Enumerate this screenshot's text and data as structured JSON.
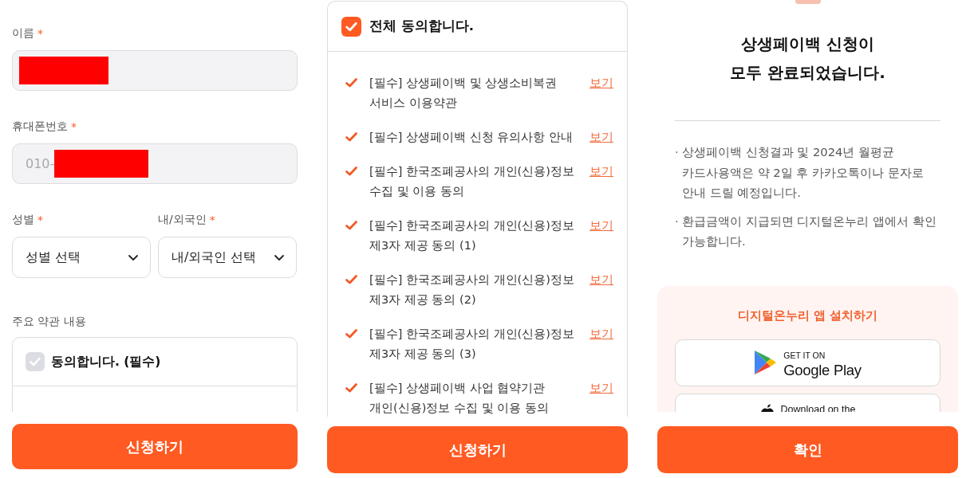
{
  "form_panel": {
    "fields": [
      {
        "label": "이름",
        "required_mark": "*",
        "redacted": true,
        "disabled": true
      },
      {
        "label": "휴대폰번호",
        "required_mark": "*",
        "value": "010-",
        "redacted": true,
        "disabled": true
      }
    ],
    "selects": [
      {
        "label": "성별",
        "required_mark": "*",
        "placeholder": "성별 선택"
      },
      {
        "label": "내/외국인",
        "required_mark": "*",
        "placeholder": "내/외국인 선택"
      }
    ],
    "terms_label": "주요 약관 내용",
    "terms_box": {
      "agree_label": "동의합니다. (필수)",
      "checked": false
    },
    "submit_button": "신청하기"
  },
  "agreement_panel": {
    "all_agree": {
      "label": "전체 동의합니다.",
      "checked": true
    },
    "items": [
      {
        "text": "[필수] 상생페이백 및 상생소비복권\n서비스 이용약관",
        "checked": true,
        "link": "보기"
      },
      {
        "text": "[필수] 상생페이백 신청 유의사항 안내",
        "checked": true,
        "link": "보기"
      },
      {
        "text": "[필수] 한국조폐공사의 개인(신용)정보\n수집 및 이용 동의",
        "checked": true,
        "link": "보기"
      },
      {
        "text": "[필수] 한국조폐공사의 개인(신용)정보\n제3자 제공 동의 (1)",
        "checked": true,
        "link": "보기"
      },
      {
        "text": "[필수] 한국조폐공사의 개인(신용)정보\n제3자 제공 동의 (2)",
        "checked": true,
        "link": "보기"
      },
      {
        "text": "[필수] 한국조폐공사의 개인(신용)정보\n제3자 제공 동의 (3)",
        "checked": true,
        "link": "보기"
      },
      {
        "text": "[필수] 상생페이백 사업 협약기관\n개인(신용)정보 수집 및 이용 동의",
        "checked": true,
        "link": "보기"
      }
    ],
    "submit_button": "신청하기"
  },
  "complete_panel": {
    "title": "상생페이백 신청이\n모두 완료되었습니다.",
    "notes": [
      {
        "bullet": "·",
        "text": "상생페이백 신청결과 및 2024년 월평균\n카드사용액은 약 2일 후 카카오톡이나 문자로\n안내 드릴 예정입니다."
      },
      {
        "bullet": "·",
        "text": "환급금액이 지급되면 디지털온누리 앱에서 확인\n가능합니다."
      }
    ],
    "install_card": {
      "title": "디지털온누리 앱 설치하기",
      "stores": [
        {
          "kind": "google_play",
          "caption": "GET IT ON",
          "name": "Google Play"
        },
        {
          "kind": "app_store",
          "caption": "Download on the"
        }
      ]
    },
    "confirm_button": "확인"
  }
}
